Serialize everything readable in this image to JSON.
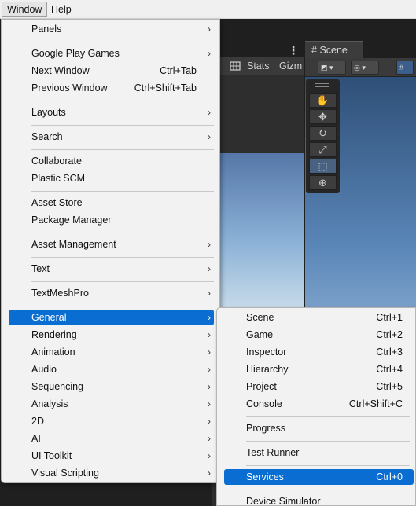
{
  "menubar": {
    "window": "Window",
    "help": "Help"
  },
  "game_toolbar": {
    "grid_icon": "grid-icon",
    "stats": "Stats",
    "gizmos": "Gizm",
    "kebab": "⋮"
  },
  "scene_tab": {
    "icon": "#",
    "label": "Scene"
  },
  "tools": [
    "hand-tool-icon",
    "move-tool-icon",
    "rotate-tool-icon",
    "scale-tool-icon",
    "rect-tool-icon",
    "transform-tool-icon"
  ],
  "window_menu": {
    "items": [
      {
        "label": "Panels",
        "submenu": true
      },
      {
        "label": "Google Play Games",
        "submenu": true
      },
      {
        "label": "Next Window",
        "shortcut": "Ctrl+Tab"
      },
      {
        "label": "Previous Window",
        "shortcut": "Ctrl+Shift+Tab"
      },
      {
        "label": "Layouts",
        "submenu": true
      },
      {
        "label": "Search",
        "submenu": true
      },
      {
        "label": "Collaborate"
      },
      {
        "label": "Plastic SCM"
      },
      {
        "label": "Asset Store"
      },
      {
        "label": "Package Manager"
      },
      {
        "label": "Asset Management",
        "submenu": true
      },
      {
        "label": "Text",
        "submenu": true
      },
      {
        "label": "TextMeshPro",
        "submenu": true
      },
      {
        "label": "General",
        "submenu": true,
        "highlighted": true
      },
      {
        "label": "Rendering",
        "submenu": true
      },
      {
        "label": "Animation",
        "submenu": true
      },
      {
        "label": "Audio",
        "submenu": true
      },
      {
        "label": "Sequencing",
        "submenu": true
      },
      {
        "label": "Analysis",
        "submenu": true
      },
      {
        "label": "2D",
        "submenu": true
      },
      {
        "label": "AI",
        "submenu": true
      },
      {
        "label": "UI Toolkit",
        "submenu": true
      },
      {
        "label": "Visual Scripting",
        "submenu": true
      }
    ]
  },
  "general_submenu": {
    "items": [
      {
        "label": "Scene",
        "shortcut": "Ctrl+1"
      },
      {
        "label": "Game",
        "shortcut": "Ctrl+2"
      },
      {
        "label": "Inspector",
        "shortcut": "Ctrl+3"
      },
      {
        "label": "Hierarchy",
        "shortcut": "Ctrl+4"
      },
      {
        "label": "Project",
        "shortcut": "Ctrl+5"
      },
      {
        "label": "Console",
        "shortcut": "Ctrl+Shift+C"
      },
      {
        "label": "Progress"
      },
      {
        "label": "Test Runner"
      },
      {
        "label": "Services",
        "shortcut": "Ctrl+0",
        "highlighted": true
      },
      {
        "label": "Device Simulator"
      }
    ]
  },
  "colors": {
    "highlight": "#0a6dd1",
    "menu_bg": "#f2f2f2",
    "editor_bg": "#1f1f1f"
  }
}
